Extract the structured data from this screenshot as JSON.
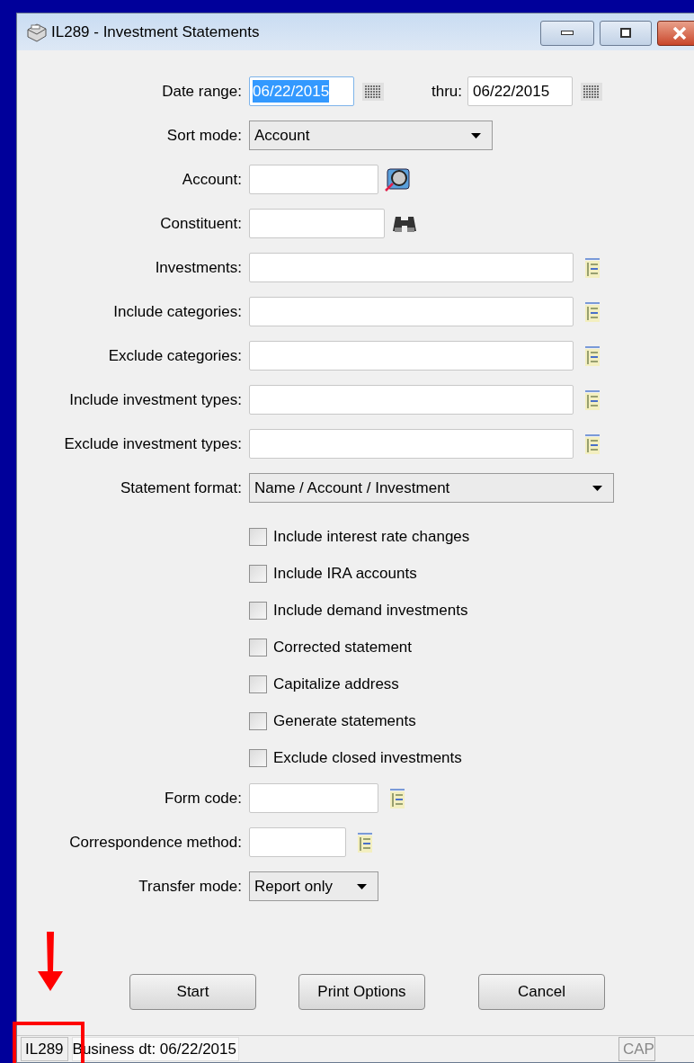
{
  "window": {
    "title": "IL289 - Investment Statements"
  },
  "fields": [
    {
      "kind": "date_range",
      "label": "Date range:",
      "from": {
        "value": "06/22/2015",
        "selected": true
      },
      "thru_label": "thru:",
      "thru": {
        "value": "06/22/2015",
        "selected": false
      }
    },
    {
      "kind": "select",
      "label": "Sort mode:",
      "value": "Account"
    },
    {
      "kind": "lookup",
      "label": "Account:"
    },
    {
      "kind": "search",
      "label": "Constituent:"
    },
    {
      "kind": "list",
      "label": "Investments:"
    },
    {
      "kind": "list",
      "label": "Include categories:"
    },
    {
      "kind": "list",
      "label": "Exclude categories:"
    },
    {
      "kind": "list",
      "label": "Include investment types:"
    },
    {
      "kind": "list",
      "label": "Exclude investment types:"
    },
    {
      "kind": "select",
      "label": "Statement format:",
      "value": "Name / Account / Investment"
    }
  ],
  "options": [
    {
      "label": "Include interest rate changes",
      "checked": false
    },
    {
      "label": "Include IRA accounts",
      "checked": false
    },
    {
      "label": "Include demand investments",
      "checked": false
    },
    {
      "label": "Corrected statement",
      "checked": false
    },
    {
      "label": "Capitalize address",
      "checked": false
    },
    {
      "label": "Generate statements",
      "checked": false
    },
    {
      "label": "Exclude closed investments",
      "checked": false
    }
  ],
  "more_fields": [
    {
      "kind": "list",
      "label": "Form code:"
    },
    {
      "kind": "list",
      "label": "Correspondence method:"
    },
    {
      "kind": "select",
      "label": "Transfer mode:",
      "value": "Report only"
    }
  ],
  "buttons": [
    "Start",
    "Print Options",
    "Cancel"
  ],
  "status_bar": {
    "code": "IL289",
    "business_date": "Business dt: 06/22/2015",
    "caps": "CAP"
  }
}
